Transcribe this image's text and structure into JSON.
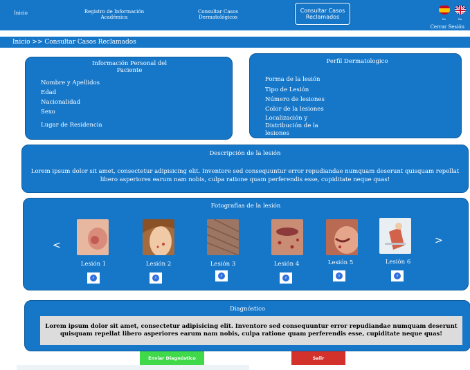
{
  "nav": {
    "home": "Inicio",
    "academic": "Registro de Información Académica",
    "derm_cases": "Consultar Casos Dermatológicos",
    "claimed_cases": "Consultar Casos Reclamados",
    "lang_es": "Es",
    "lang_en": "En",
    "logout": "Cerrar Sesión"
  },
  "breadcrumb": "Inicio >> Consultar Casos Reclamados",
  "personal": {
    "title": "Información Personal del Paciente",
    "fields": [
      "Nombre y Apellidos",
      "Edad",
      "Nacionalidad",
      "Sexo",
      "Lugar de Residencia"
    ]
  },
  "profile": {
    "title": "Perfil Dermatologico",
    "fields": [
      "Forma de la lesión",
      "Tipo de Lesión",
      "Número de lesiones",
      "Color de la lesiones",
      "Localización y Distribución de la lesiones"
    ]
  },
  "description": {
    "title": "Descripción de la lesión",
    "text": "Lorem ipsum dolor sit amet, consectetur adipisicing elit. Inventore sed consequuntur error repudiandae numquam deserunt quisquam repellat libero asperiores earum nam nobis, culpa ratione quam perferendis esse, cupiditate neque quas!"
  },
  "photos": {
    "title": "Fotografías de la lesión",
    "prev": "<",
    "next": ">",
    "items": [
      "Lesión 1",
      "Lesión 2",
      "Lesión 3",
      "Lesión 4",
      "Lesión 5",
      "Lesión 6"
    ]
  },
  "diagnosis": {
    "title": "Diagnóstico",
    "text": "Lorem ipsum dolor sit amet, consectetur adipisicing elit. Inventore sed consequuntur error repudiandae numquam deserunt quisquam repellat libero asperiores earum nam nobis, culpa ratione quam perferendis esse, cupiditate neque quas!"
  },
  "actions": {
    "send": "Enviar Diagnóstico",
    "exit": "Salir"
  },
  "colors": {
    "primary": "#1677c9",
    "send": "#3fd94a",
    "exit": "#d3312b"
  }
}
